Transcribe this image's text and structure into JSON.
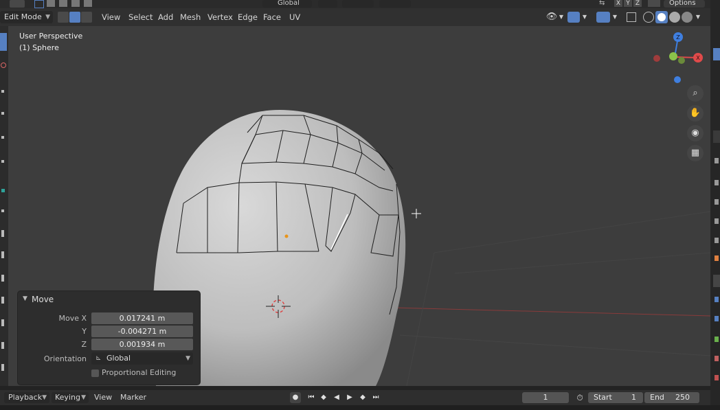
{
  "header": {
    "mode": "Edit Mode",
    "menu": [
      "View",
      "Select",
      "Add",
      "Mesh",
      "Vertex",
      "Edge",
      "Face",
      "UV"
    ],
    "transform_orientation": "Global",
    "axis_x": "X",
    "axis_y": "Y",
    "axis_z": "Z",
    "options_label": "Options"
  },
  "viewport": {
    "view_name": "User Perspective",
    "object_name": "(1) Sphere",
    "gizmo": {
      "x": "X",
      "y": "Y",
      "z": "Z"
    },
    "colors": {
      "x_axis": "#e04a4a",
      "y_axis": "#8bc34a",
      "z_axis": "#3f7fe0"
    }
  },
  "operator_panel": {
    "title": "Move",
    "fields": [
      {
        "label": "Move X",
        "value": "0.017241 m"
      },
      {
        "label": "Y",
        "value": "-0.004271 m"
      },
      {
        "label": "Z",
        "value": "0.001934 m"
      }
    ],
    "orientation_label": "Orientation",
    "orientation_value": "Global",
    "proportional_label": "Proportional Editing"
  },
  "timeline": {
    "playback": "Playback",
    "keying": "Keying",
    "view": "View",
    "marker": "Marker",
    "current_frame": "1",
    "start_label": "Start",
    "start_value": "1",
    "end_label": "End",
    "end_value": "250"
  }
}
